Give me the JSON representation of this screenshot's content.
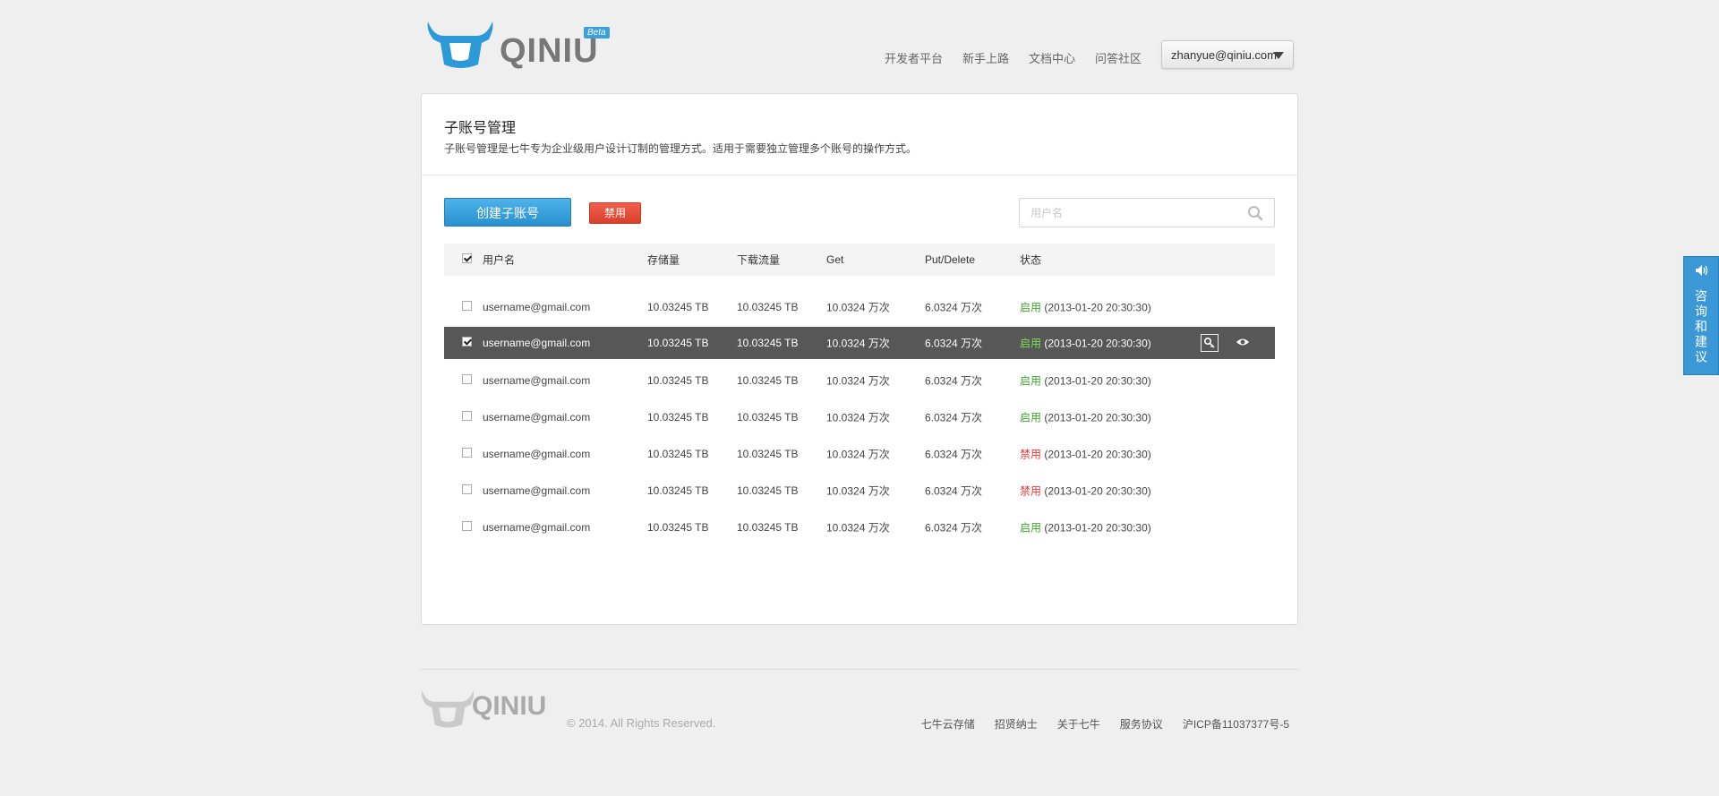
{
  "header": {
    "logo_text": "QINIU",
    "beta": "Beta",
    "nav": [
      "开发者平台",
      "新手上路",
      "文档中心",
      "问答社区"
    ],
    "user_email": "zhanyue@qiniu.com"
  },
  "panel": {
    "title": "子账号管理",
    "description": "子账号管理是七牛专为企业级用户设计订制的管理方式。适用于需要独立管理多个账号的操作方式。",
    "create_button": "创建子账号",
    "disable_button": "禁用",
    "search_placeholder": "用户名"
  },
  "table": {
    "columns": [
      "用户名",
      "存储量",
      "下载流量",
      "Get",
      "Put/Delete",
      "状态"
    ],
    "header_checked": true,
    "rows": [
      {
        "user": "username@gmail.com",
        "storage": "10.03245 TB",
        "download": "10.03245 TB",
        "get": "10.0324 万次",
        "put": "6.0324 万次",
        "status": "启用",
        "status_on": true,
        "time": "(2013-01-20 20:30:30)",
        "checked": false,
        "selected": false
      },
      {
        "user": "username@gmail.com",
        "storage": "10.03245 TB",
        "download": "10.03245 TB",
        "get": "10.0324 万次",
        "put": "6.0324 万次",
        "status": "启用",
        "status_on": true,
        "time": "(2013-01-20 20:30:30)",
        "checked": true,
        "selected": true
      },
      {
        "user": "username@gmail.com",
        "storage": "10.03245 TB",
        "download": "10.03245 TB",
        "get": "10.0324 万次",
        "put": "6.0324 万次",
        "status": "启用",
        "status_on": true,
        "time": "(2013-01-20 20:30:30)",
        "checked": false,
        "selected": false
      },
      {
        "user": "username@gmail.com",
        "storage": "10.03245 TB",
        "download": "10.03245 TB",
        "get": "10.0324 万次",
        "put": "6.0324 万次",
        "status": "启用",
        "status_on": true,
        "time": "(2013-01-20 20:30:30)",
        "checked": false,
        "selected": false
      },
      {
        "user": "username@gmail.com",
        "storage": "10.03245 TB",
        "download": "10.03245 TB",
        "get": "10.0324 万次",
        "put": "6.0324 万次",
        "status": "禁用",
        "status_on": false,
        "time": "(2013-01-20 20:30:30)",
        "checked": false,
        "selected": false
      },
      {
        "user": "username@gmail.com",
        "storage": "10.03245 TB",
        "download": "10.03245 TB",
        "get": "10.0324 万次",
        "put": "6.0324 万次",
        "status": "禁用",
        "status_on": false,
        "time": "(2013-01-20 20:30:30)",
        "checked": false,
        "selected": false
      },
      {
        "user": "username@gmail.com",
        "storage": "10.03245 TB",
        "download": "10.03245 TB",
        "get": "10.0324 万次",
        "put": "6.0324 万次",
        "status": "启用",
        "status_on": true,
        "time": "(2013-01-20 20:30:30)",
        "checked": false,
        "selected": false
      }
    ],
    "row_actions": [
      "key-icon",
      "eye-icon"
    ]
  },
  "footer": {
    "logo_text": "QINIU",
    "copyright": "© 2014. All Rights Reserved.",
    "links": [
      "七牛云存储",
      "招贤纳士",
      "关于七牛",
      "服务协议",
      "沪ICP备11037377号-5"
    ]
  },
  "side_tab": {
    "label": "咨询和建议"
  },
  "colors": {
    "accent": "#3b98d6",
    "danger": "#e03a3a",
    "success": "#3fa52f",
    "selected_row": "#575757"
  }
}
